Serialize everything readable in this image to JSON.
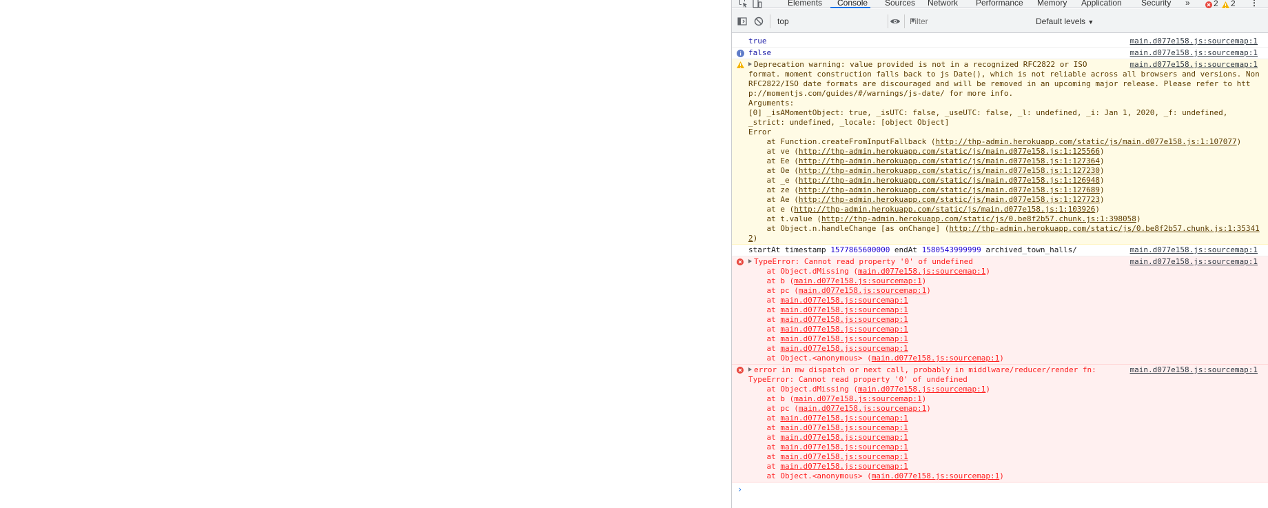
{
  "devtools": {
    "tabs": [
      "Elements",
      "Console",
      "Sources",
      "Network",
      "Performance",
      "Memory",
      "Application",
      "Security"
    ],
    "more_tabs": "»",
    "error_count": "2",
    "warning_count": "2",
    "more_menu": "⋮"
  },
  "toolbar": {
    "context": "top",
    "filter_placeholder": "Filter",
    "levels": "Default levels"
  },
  "console": {
    "messages": [
      {
        "type": "log",
        "text": "true",
        "source": "main.d077e158.js:sourcemap:1"
      },
      {
        "type": "info",
        "text": "false",
        "source": "main.d077e158.js:sourcemap:1"
      },
      {
        "type": "warning",
        "source": "main.d077e158.js:sourcemap:1",
        "lines": [
          "Deprecation warning: value provided is not in a recognized RFC2822 or ISO",
          "format. moment construction falls back to js Date(), which is not reliable across all browsers and versions. Non",
          "RFC2822/ISO date formats are discouraged and will be removed in an upcoming major release. Please refer to htt",
          "p://momentjs.com/guides/#/warnings/js-date/ for more info.",
          "Arguments:",
          "[0] _isAMomentObject: true, _isUTC: false, _useUTC: false, _l: undefined, _i: Jan 1, 2020, _f: undefined,",
          "_strict: undefined, _locale: [object Object]",
          "Error"
        ],
        "stack": [
          {
            "fn": "    at Function.createFromInputFallback (",
            "url": "http://thp-admin.herokuapp.com/static/js/main.d077e158.js:1:107077",
            "end": ")"
          },
          {
            "fn": "    at ve (",
            "url": "http://thp-admin.herokuapp.com/static/js/main.d077e158.js:1:125566",
            "end": ")"
          },
          {
            "fn": "    at Ee (",
            "url": "http://thp-admin.herokuapp.com/static/js/main.d077e158.js:1:127364",
            "end": ")"
          },
          {
            "fn": "    at Oe (",
            "url": "http://thp-admin.herokuapp.com/static/js/main.d077e158.js:1:127230",
            "end": ")"
          },
          {
            "fn": "    at _e (",
            "url": "http://thp-admin.herokuapp.com/static/js/main.d077e158.js:1:126948",
            "end": ")"
          },
          {
            "fn": "    at ze (",
            "url": "http://thp-admin.herokuapp.com/static/js/main.d077e158.js:1:127689",
            "end": ")"
          },
          {
            "fn": "    at Ae (",
            "url": "http://thp-admin.herokuapp.com/static/js/main.d077e158.js:1:127723",
            "end": ")"
          },
          {
            "fn": "    at e (",
            "url": "http://thp-admin.herokuapp.com/static/js/main.d077e158.js:1:103926",
            "end": ")"
          },
          {
            "fn": "    at t.value (",
            "url": "http://thp-admin.herokuapp.com/static/js/0.be8f2b57.chunk.js:1:398058",
            "end": ")"
          },
          {
            "fn": "    at Object.n.handleChange [as onChange] (",
            "url": "http://thp-admin.herokuapp.com/static/js/0.be8f2b57.chunk.js:1:35341",
            "end": ""
          },
          {
            "fn": "",
            "url": "2",
            "end": ")"
          }
        ]
      },
      {
        "type": "log",
        "source": "main.d077e158.js:sourcemap:1",
        "parts": [
          "startAt timestamp ",
          "1577865600000",
          " endAt ",
          "1580543999999",
          " archived_town_halls/"
        ]
      },
      {
        "type": "error",
        "source": "main.d077e158.js:sourcemap:1",
        "head": "TypeError: Cannot read property '0' of undefined",
        "stack": [
          {
            "fn": "    at Object.dMissing (",
            "url": "main.d077e158.js:sourcemap:1",
            "end": ")"
          },
          {
            "fn": "    at b (",
            "url": "main.d077e158.js:sourcemap:1",
            "end": ")"
          },
          {
            "fn": "    at pc (",
            "url": "main.d077e158.js:sourcemap:1",
            "end": ")"
          },
          {
            "fn": "    at ",
            "url": "main.d077e158.js:sourcemap:1",
            "end": ""
          },
          {
            "fn": "    at ",
            "url": "main.d077e158.js:sourcemap:1",
            "end": ""
          },
          {
            "fn": "    at ",
            "url": "main.d077e158.js:sourcemap:1",
            "end": ""
          },
          {
            "fn": "    at ",
            "url": "main.d077e158.js:sourcemap:1",
            "end": ""
          },
          {
            "fn": "    at ",
            "url": "main.d077e158.js:sourcemap:1",
            "end": ""
          },
          {
            "fn": "    at ",
            "url": "main.d077e158.js:sourcemap:1",
            "end": ""
          },
          {
            "fn": "    at Object.<anonymous> (",
            "url": "main.d077e158.js:sourcemap:1",
            "end": ")"
          }
        ]
      },
      {
        "type": "error",
        "source": "main.d077e158.js:sourcemap:1",
        "head": "error in mw dispatch or next call, probably in middlware/reducer/render fn:",
        "head2": "TypeError: Cannot read property '0' of undefined",
        "stack": [
          {
            "fn": "    at Object.dMissing (",
            "url": "main.d077e158.js:sourcemap:1",
            "end": ")"
          },
          {
            "fn": "    at b (",
            "url": "main.d077e158.js:sourcemap:1",
            "end": ")"
          },
          {
            "fn": "    at pc (",
            "url": "main.d077e158.js:sourcemap:1",
            "end": ")"
          },
          {
            "fn": "    at ",
            "url": "main.d077e158.js:sourcemap:1",
            "end": ""
          },
          {
            "fn": "    at ",
            "url": "main.d077e158.js:sourcemap:1",
            "end": ""
          },
          {
            "fn": "    at ",
            "url": "main.d077e158.js:sourcemap:1",
            "end": ""
          },
          {
            "fn": "    at ",
            "url": "main.d077e158.js:sourcemap:1",
            "end": ""
          },
          {
            "fn": "    at ",
            "url": "main.d077e158.js:sourcemap:1",
            "end": ""
          },
          {
            "fn": "    at ",
            "url": "main.d077e158.js:sourcemap:1",
            "end": ""
          },
          {
            "fn": "    at Object.<anonymous> (",
            "url": "main.d077e158.js:sourcemap:1",
            "end": ")"
          }
        ]
      }
    ],
    "prompt_caret": "›"
  },
  "colors": {
    "tab_active_underline": "#1a73e8",
    "warning_bg": "#fffbe5",
    "error_bg": "#fff0f0",
    "error_text": "#fe2020",
    "number": "#1c00cf"
  }
}
